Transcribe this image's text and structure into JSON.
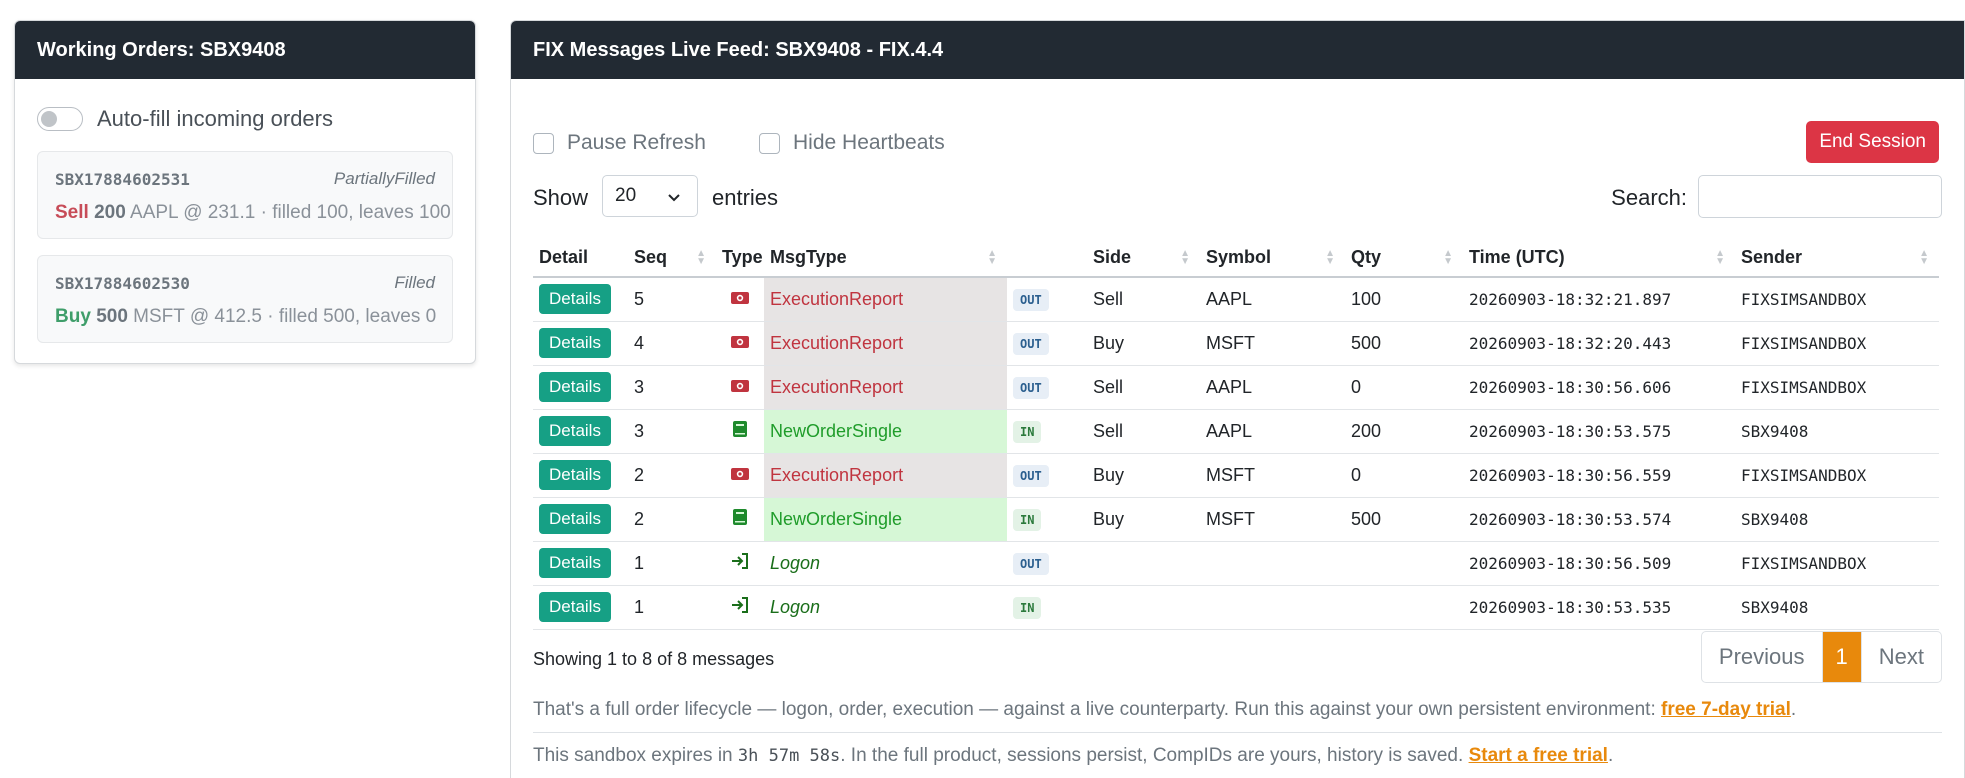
{
  "left": {
    "title": "Working Orders: SBX9408",
    "autofill_label": "Auto-fill incoming orders",
    "orders": [
      {
        "id": "SBX17884602531",
        "status": "PartiallyFilled",
        "side": "Sell",
        "qty": "200",
        "desc": "AAPL @ 231.1 · filled 100, leaves 100"
      },
      {
        "id": "SBX17884602530",
        "status": "Filled",
        "side": "Buy",
        "qty": "500",
        "desc": "MSFT @ 412.5 · filled 500, leaves 0"
      }
    ]
  },
  "feed": {
    "title": "FIX Messages Live Feed: SBX9408 - FIX.4.4",
    "pause_label": "Pause Refresh",
    "hide_label": "Hide Heartbeats",
    "end_label": "End Session",
    "show_label": "Show",
    "entries_value": "20",
    "entries_label": "entries",
    "search_label": "Search:",
    "columns": [
      "Detail",
      "Seq",
      "Type",
      "MsgType",
      "",
      "Side",
      "Symbol",
      "Qty",
      "Time (UTC)",
      "Sender"
    ],
    "rows": [
      {
        "detail": "Details",
        "seq": "5",
        "icon": "money-icon",
        "msgtype": "ExecutionReport",
        "dir": "OUT",
        "side": "Sell",
        "symbol": "AAPL",
        "qty": "100",
        "time": "20260903-18:32:21.897",
        "sender": "FIXSIMSANDBOX"
      },
      {
        "detail": "Details",
        "seq": "4",
        "icon": "money-icon",
        "msgtype": "ExecutionReport",
        "dir": "OUT",
        "side": "Buy",
        "symbol": "MSFT",
        "qty": "500",
        "time": "20260903-18:32:20.443",
        "sender": "FIXSIMSANDBOX"
      },
      {
        "detail": "Details",
        "seq": "3",
        "icon": "money-icon",
        "msgtype": "ExecutionReport",
        "dir": "OUT",
        "side": "Sell",
        "symbol": "AAPL",
        "qty": "0",
        "time": "20260903-18:30:56.606",
        "sender": "FIXSIMSANDBOX"
      },
      {
        "detail": "Details",
        "seq": "3",
        "icon": "book-icon",
        "msgtype": "NewOrderSingle",
        "dir": "IN",
        "side": "Sell",
        "symbol": "AAPL",
        "qty": "200",
        "time": "20260903-18:30:53.575",
        "sender": "SBX9408"
      },
      {
        "detail": "Details",
        "seq": "2",
        "icon": "money-icon",
        "msgtype": "ExecutionReport",
        "dir": "OUT",
        "side": "Buy",
        "symbol": "MSFT",
        "qty": "0",
        "time": "20260903-18:30:56.559",
        "sender": "FIXSIMSANDBOX"
      },
      {
        "detail": "Details",
        "seq": "2",
        "icon": "book-icon",
        "msgtype": "NewOrderSingle",
        "dir": "IN",
        "side": "Buy",
        "symbol": "MSFT",
        "qty": "500",
        "time": "20260903-18:30:53.574",
        "sender": "SBX9408"
      },
      {
        "detail": "Details",
        "seq": "1",
        "icon": "login-icon",
        "msgtype": "Logon",
        "dir": "OUT",
        "side": "",
        "symbol": "",
        "qty": "",
        "time": "20260903-18:30:56.509",
        "sender": "FIXSIMSANDBOX"
      },
      {
        "detail": "Details",
        "seq": "1",
        "icon": "login-icon",
        "msgtype": "Logon",
        "dir": "IN",
        "side": "",
        "symbol": "",
        "qty": "",
        "time": "20260903-18:30:53.535",
        "sender": "SBX9408"
      }
    ],
    "showing": "Showing 1 to 8 of 8 messages",
    "pager": {
      "prev": "Previous",
      "page": "1",
      "next": "Next"
    },
    "note1_text": "That's a full order lifecycle — logon, order, execution — against a live counterparty. Run this against your own persistent environment: ",
    "note1_link": "free 7-day trial",
    "note1_end": ".",
    "note2_pre": "This sandbox expires in ",
    "note2_time": "3h 57m 58s",
    "note2_mid": ". In the full product, sessions persist, CompIDs are yours, history is saved. ",
    "note2_link": "Start a free trial",
    "note2_end": "."
  }
}
